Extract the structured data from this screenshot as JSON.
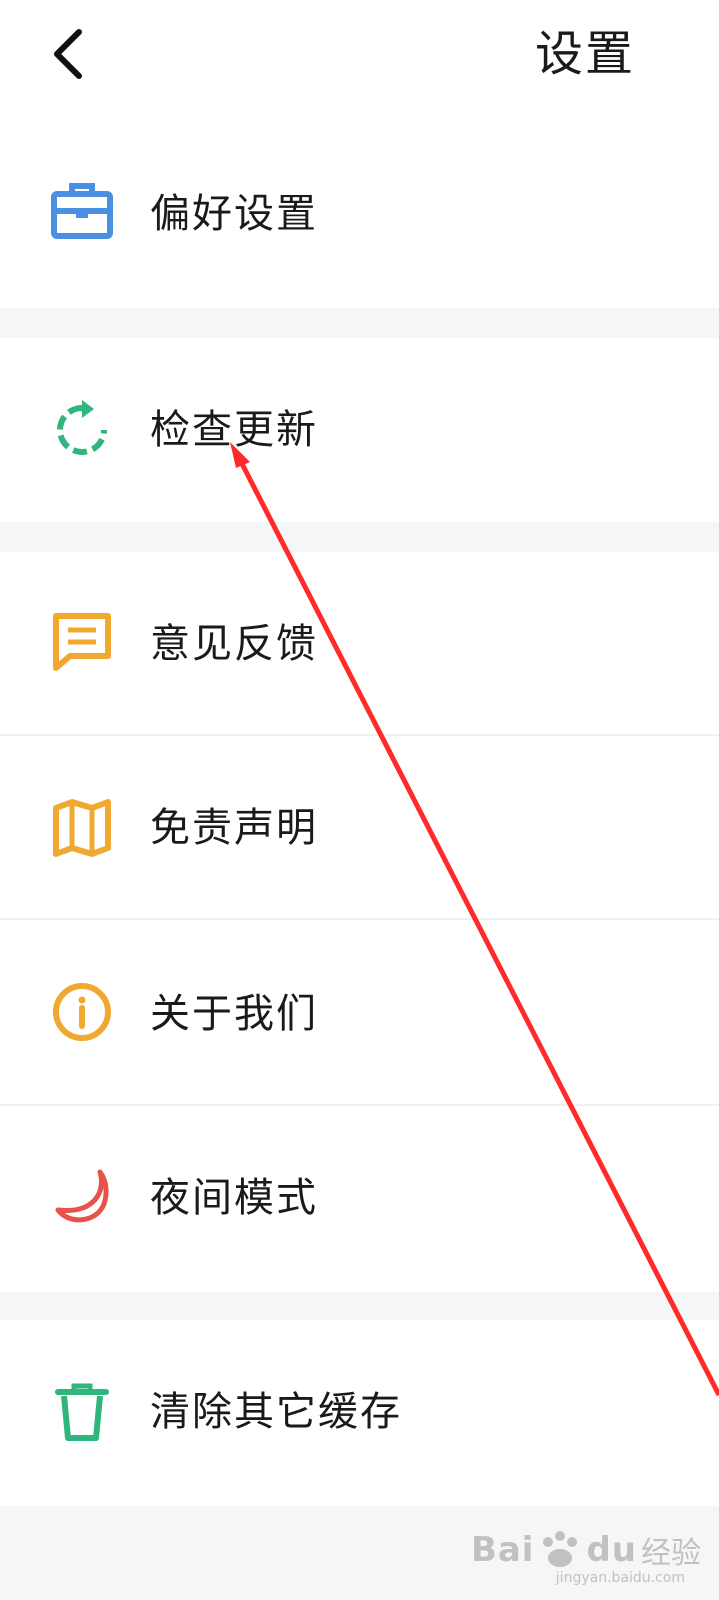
{
  "header": {
    "back_icon": "chevron-left-icon",
    "title": "设置"
  },
  "menu": [
    {
      "id": "preferences",
      "label": "偏好设置",
      "icon": "briefcase-icon",
      "color": "#4a90e2"
    },
    {
      "id": "check-update",
      "label": "检查更新",
      "icon": "refresh-icon",
      "color": "#2eb67d"
    },
    {
      "id": "feedback",
      "label": "意见反馈",
      "icon": "chat-icon",
      "color": "#f0a830"
    },
    {
      "id": "disclaimer",
      "label": "免责声明",
      "icon": "map-icon",
      "color": "#f0a830"
    },
    {
      "id": "about",
      "label": "关于我们",
      "icon": "info-icon",
      "color": "#f0a830"
    },
    {
      "id": "night-mode",
      "label": "夜间模式",
      "icon": "moon-icon",
      "color": "#e5534b"
    },
    {
      "id": "clear-cache",
      "label": "清除其它缓存",
      "icon": "trash-icon",
      "color": "#2eb67d"
    }
  ],
  "annotation": {
    "arrow_color": "#ff2a2a",
    "points_to": "检查更新"
  },
  "watermark": {
    "brand": "Bai",
    "brand_tail": "du",
    "suffix": "经验",
    "url": "jingyan.baidu.com"
  }
}
